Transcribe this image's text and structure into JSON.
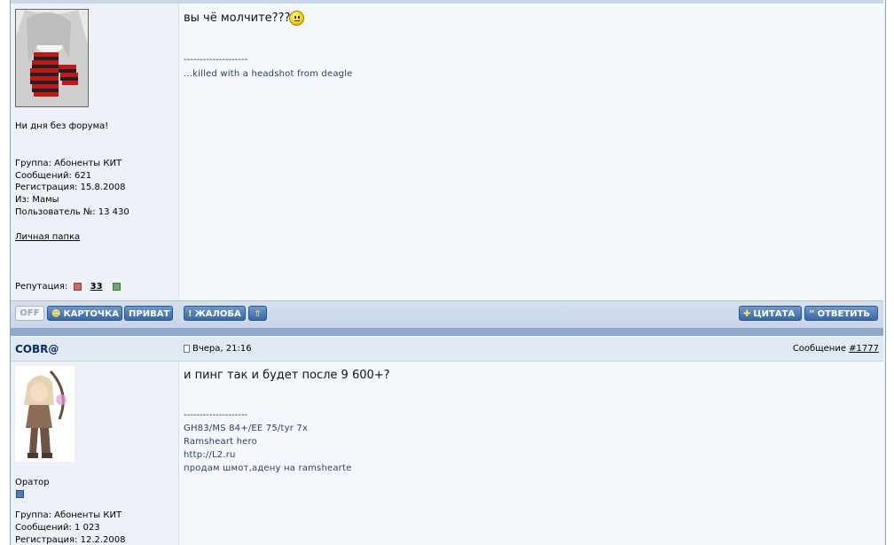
{
  "post1": {
    "signature_tagline": "Ни дня без форума!",
    "user": {
      "group": "Группа: Абоненты КИТ",
      "posts": "Сообщений: 621",
      "registered": "Регистрация: 15.8.2008",
      "from": "Из: Мамы",
      "user_no": "Пользователь №: 13 430",
      "folder_link": "Личная папка",
      "reputation_label": "Репутация:",
      "reputation_value": "33"
    },
    "message": "вы чё молчите???",
    "signature_divider": "--------------------",
    "signature": "...killed with a headshot from deagle"
  },
  "bar": {
    "off_label": "OFF",
    "profile_label": "КАРТОЧКА",
    "private_label": "ПРИВАТ",
    "report_label": "ЖАЛОБА",
    "quote_label": "ЦИТАТА",
    "reply_label": "ОТВЕТИТЬ"
  },
  "post2": {
    "author": "COBR@",
    "date": "Вчера, 21:16",
    "message_label": "Сообщение",
    "message_number": "#1777",
    "rank": "Оратор",
    "user": {
      "group": "Группа: Абоненты КИТ",
      "posts": "Сообщений: 1 023",
      "registered": "Регистрация: 12.2.2008"
    },
    "message": "и пинг так и будет после 9 600+?",
    "signature_divider": "--------------------",
    "signature_lines": [
      "GH83/MS 84+/EE 75/tyr 7x",
      "Ramsheart hero",
      "http://L2.ru",
      "продам шмот,адену на ramshearte"
    ]
  },
  "colors": {
    "bar_bg": "#c7d5e7",
    "button_bg": "#3a67a6",
    "separator": "#8ea9c9",
    "author": "#0b2a6e",
    "signature": "#2b3f6b"
  },
  "icons": {
    "smiley": "smile-icon",
    "profile": "user-icon",
    "report": "exclamation-icon",
    "up": "arrow-up-icon",
    "quote": "plus-icon",
    "reply": "quote-marks-icon",
    "post": "document-icon"
  }
}
